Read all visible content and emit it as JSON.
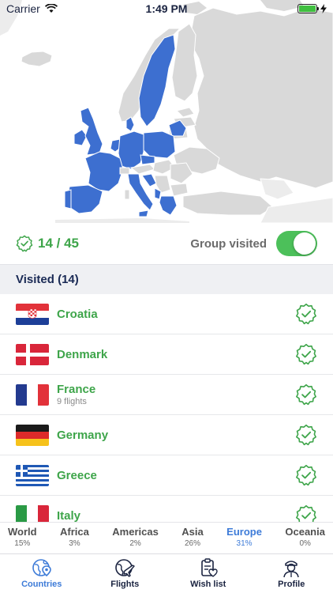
{
  "status_bar": {
    "carrier": "Carrier",
    "time": "1:49 PM"
  },
  "map": {
    "visited_color": "#3d6fd0",
    "unvisited_color": "#d9d9d9",
    "border_color": "#ffffff"
  },
  "summary": {
    "count": "14 / 45",
    "group_label": "Group visited",
    "group_visited_on": true
  },
  "section": {
    "title": "Visited (14)"
  },
  "countries": [
    {
      "name": "Croatia",
      "sub": "",
      "flag": "croatia"
    },
    {
      "name": "Denmark",
      "sub": "",
      "flag": "denmark"
    },
    {
      "name": "France",
      "sub": "9 flights",
      "flag": "france"
    },
    {
      "name": "Germany",
      "sub": "",
      "flag": "germany"
    },
    {
      "name": "Greece",
      "sub": "",
      "flag": "greece"
    },
    {
      "name": "Italy",
      "sub": "",
      "flag": "italy"
    }
  ],
  "continents": [
    {
      "name": "World",
      "pct": "15%"
    },
    {
      "name": "Africa",
      "pct": "3%"
    },
    {
      "name": "Americas",
      "pct": "2%"
    },
    {
      "name": "Asia",
      "pct": "26%"
    },
    {
      "name": "Europe",
      "pct": "31%",
      "active": true
    },
    {
      "name": "Oceania",
      "pct": "0%"
    }
  ],
  "tabs": [
    {
      "label": "Countries",
      "icon": "globe-pin-icon",
      "active": true
    },
    {
      "label": "Flights",
      "icon": "globe-plane-icon"
    },
    {
      "label": "Wish list",
      "icon": "clipboard-heart-icon"
    },
    {
      "label": "Profile",
      "icon": "pilot-icon"
    }
  ],
  "colors": {
    "accent_green": "#3ea54a",
    "accent_blue": "#3d7bd8",
    "toggle_green": "#4cc05a"
  }
}
